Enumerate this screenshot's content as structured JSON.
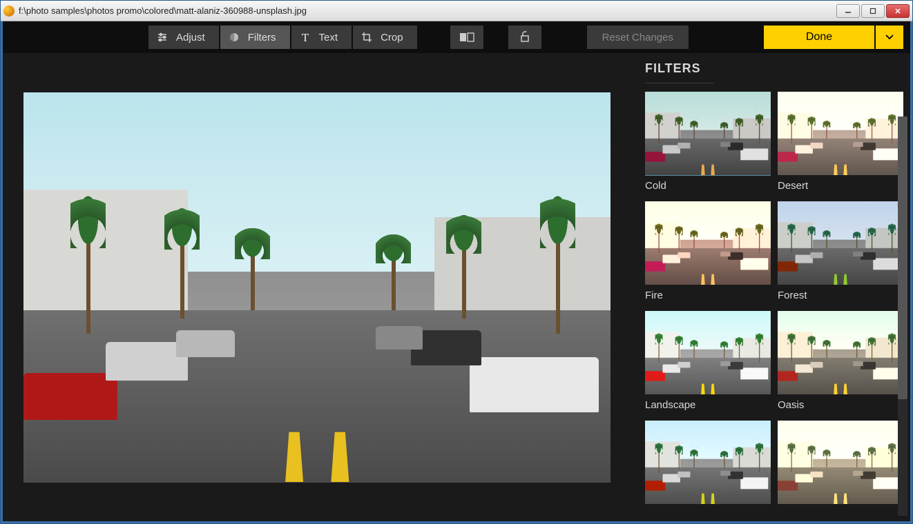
{
  "window": {
    "title": "f:\\photo samples\\photos promo\\colored\\matt-alaniz-360988-unsplash.jpg"
  },
  "toolbar": {
    "tabs": [
      {
        "label": "Adjust"
      },
      {
        "label": "Filters"
      },
      {
        "label": "Text"
      },
      {
        "label": "Crop"
      }
    ],
    "reset_label": "Reset Changes",
    "done_label": "Done"
  },
  "sidebar": {
    "title": "FILTERS",
    "filters": [
      {
        "label": "Cold"
      },
      {
        "label": "Desert"
      },
      {
        "label": "Fire"
      },
      {
        "label": "Forest"
      },
      {
        "label": "Landscape"
      },
      {
        "label": "Oasis"
      },
      {
        "label": ""
      },
      {
        "label": ""
      }
    ]
  }
}
